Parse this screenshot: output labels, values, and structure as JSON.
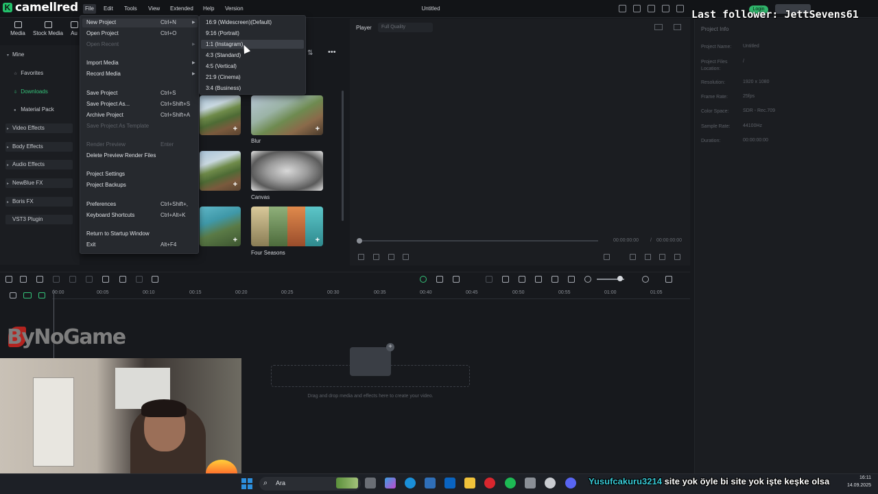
{
  "app": {
    "logo_letter": "K",
    "logo_text": "camellred",
    "title": "Untitled",
    "login_label": "Login"
  },
  "menubar": [
    "File",
    "Edit",
    "Tools",
    "View",
    "Extended",
    "Help",
    "Version"
  ],
  "media_toolbar": [
    "Media",
    "Stock Media",
    "Au"
  ],
  "left_panel": {
    "items": [
      "Mine",
      "Favorites",
      "Downloads",
      "Material Pack",
      "Video Effects",
      "Body Effects",
      "Audio Effects",
      "NewBlue FX",
      "Boris FX",
      "VST3 Plugin"
    ]
  },
  "media": {
    "blur_label": "Blur",
    "canvas_label": "Canvas",
    "seasons_label": "Four Seasons"
  },
  "file_menu": {
    "items": [
      {
        "label": "New Project",
        "shortcut": "Ctrl+N",
        "submenu": true,
        "enabled": true
      },
      {
        "label": "Open Project",
        "shortcut": "Ctrl+O",
        "submenu": false,
        "enabled": true
      },
      {
        "label": "Open Recent",
        "shortcut": "",
        "submenu": true,
        "enabled": false
      },
      {
        "label": "Import Media",
        "shortcut": "",
        "submenu": true,
        "enabled": true
      },
      {
        "label": "Record Media",
        "shortcut": "",
        "submenu": true,
        "enabled": true
      },
      {
        "label": "Save Project",
        "shortcut": "Ctrl+S",
        "submenu": false,
        "enabled": true
      },
      {
        "label": "Save Project As...",
        "shortcut": "Ctrl+Shift+S",
        "submenu": false,
        "enabled": true
      },
      {
        "label": "Archive Project",
        "shortcut": "Ctrl+Shift+A",
        "submenu": false,
        "enabled": true
      },
      {
        "label": "Save Project As Template",
        "shortcut": "",
        "submenu": false,
        "enabled": false
      },
      {
        "label": "Render Preview",
        "shortcut": "Enter",
        "submenu": false,
        "enabled": false
      },
      {
        "label": "Delete Preview Render Files",
        "shortcut": "",
        "submenu": false,
        "enabled": true
      },
      {
        "label": "Project Settings",
        "shortcut": "",
        "submenu": false,
        "enabled": true
      },
      {
        "label": "Project Backups",
        "shortcut": "",
        "submenu": false,
        "enabled": true
      },
      {
        "label": "Preferences",
        "shortcut": "Ctrl+Shift+,",
        "submenu": false,
        "enabled": true
      },
      {
        "label": "Keyboard Shortcuts",
        "shortcut": "Ctrl+Alt+K",
        "submenu": false,
        "enabled": true
      },
      {
        "label": "Return to Startup Window",
        "shortcut": "",
        "submenu": false,
        "enabled": true
      },
      {
        "label": "Exit",
        "shortcut": "Alt+F4",
        "submenu": false,
        "enabled": true
      }
    ]
  },
  "new_project_submenu": [
    "16:9 (Widescreen)(Default)",
    "9:16 (Portrait)",
    "1:1 (Instagram)",
    "4:3 (Standard)",
    "4:5 (Vertical)",
    "21:9 (Cinema)",
    "3:4 (Business)"
  ],
  "player": {
    "tab": "Player",
    "quality": "Full Quality",
    "time_current": "00:00:00:00",
    "time_separator": "/",
    "time_total": "00:00:00:00"
  },
  "project_info": {
    "title": "Project Info",
    "rows": [
      {
        "label": "Project Name:",
        "value": "Untitled"
      },
      {
        "label": "Project Files Location:",
        "value": "/"
      },
      {
        "label": "Resolution:",
        "value": "1920 x 1080"
      },
      {
        "label": "Frame Rate:",
        "value": "25fps"
      },
      {
        "label": "Color Space:",
        "value": "SDR - Rec.709"
      },
      {
        "label": "Sample Rate:",
        "value": "44100Hz"
      },
      {
        "label": "Duration:",
        "value": "00:00:00:00"
      }
    ]
  },
  "timeline": {
    "ticks": [
      "00:00",
      "00:05",
      "00:10",
      "00:15",
      "00:20",
      "00:25",
      "00:30",
      "00:35",
      "00:40",
      "00:45",
      "00:50",
      "00:55",
      "01:00",
      "01:05"
    ],
    "drop_text": "Drag and drop media and effects here to create your video."
  },
  "overlays": {
    "follower": "Last follower: JettSevens61",
    "watermark": "ByNoGame",
    "chat_user": "Yusufcakuru3214",
    "chat_message": "site yok öyle bi site yok işte keşke olsa"
  },
  "taskbar": {
    "search": "Ara",
    "time": "16:11",
    "date": "14.09.2025"
  },
  "colors": {
    "accent": "#2fb36a",
    "background": "#17191d",
    "panel": "#1b1d21",
    "menu": "#26292e"
  }
}
